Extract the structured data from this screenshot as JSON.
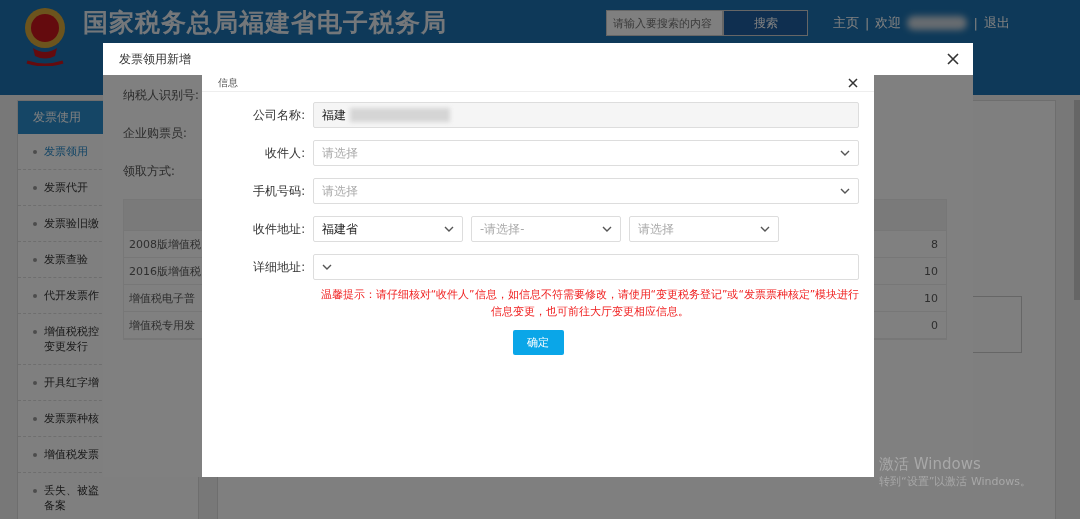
{
  "header": {
    "title": "国家税务总局福建省电子税务局",
    "search": {
      "placeholder": "请输入要搜索的内容"
    },
    "search_button": "搜索",
    "nav": [
      {
        "kind": "link",
        "text": "主页"
      },
      {
        "kind": "sep",
        "text": "|"
      },
      {
        "kind": "link",
        "text": "欢迎"
      },
      {
        "kind": "redacted"
      },
      {
        "kind": "sep",
        "text": "|"
      },
      {
        "kind": "link",
        "text": "退出"
      }
    ]
  },
  "sidebar": {
    "title": "发票使用",
    "items": [
      {
        "label": "发票领用",
        "selected": true
      },
      {
        "label": "发票代开",
        "selected": false
      },
      {
        "label": "发票验旧缴",
        "selected": false
      },
      {
        "label": "发票查验",
        "selected": false
      },
      {
        "label": "代开发票作",
        "selected": false
      },
      {
        "label": "增值税税控变更发行",
        "selected": false
      },
      {
        "label": "开具红字增",
        "selected": false
      },
      {
        "label": "发票票种核",
        "selected": false
      },
      {
        "label": "增值税发票",
        "selected": false
      },
      {
        "label": "丢失、被盗备案",
        "selected": false
      }
    ]
  },
  "dialog": {
    "title": "发票领用新增",
    "labels": [
      "纳税人识别号:",
      "企业购票员:",
      "领取方式:"
    ],
    "table": {
      "rows": [
        {
          "name": "2008版增值税",
          "count": "8"
        },
        {
          "name": "2016版增值税",
          "count": "10"
        },
        {
          "name": "增值税电子普",
          "count": "10"
        },
        {
          "name": "增值税专用发",
          "count": "0"
        }
      ]
    }
  },
  "info_dialog": {
    "title": "信息",
    "fields": [
      {
        "kind": "readonly",
        "label": "公司名称:",
        "value": "福建"
      },
      {
        "kind": "select",
        "label": "收件人:",
        "placeholder": "请选择"
      },
      {
        "kind": "select",
        "label": "手机号码:",
        "placeholder": "请选择"
      },
      {
        "kind": "address",
        "label": "收件地址:",
        "selects": [
          {
            "value": "福建省"
          },
          {
            "placeholder": "-请选择-"
          },
          {
            "placeholder": "请选择"
          }
        ]
      },
      {
        "kind": "select",
        "label": "详细地址:"
      }
    ],
    "notice": "温馨提示：请仔细核对“收件人”信息，如信息不符需要修改，请使用“变更税务登记”或“发票票种核定”模块进行信息变更，也可前往大厅变更相应信息。",
    "confirm_button": "确定"
  },
  "system_notice": {
    "title": "激活 Windows",
    "text": "转到“设置”以激活 Windows。"
  }
}
